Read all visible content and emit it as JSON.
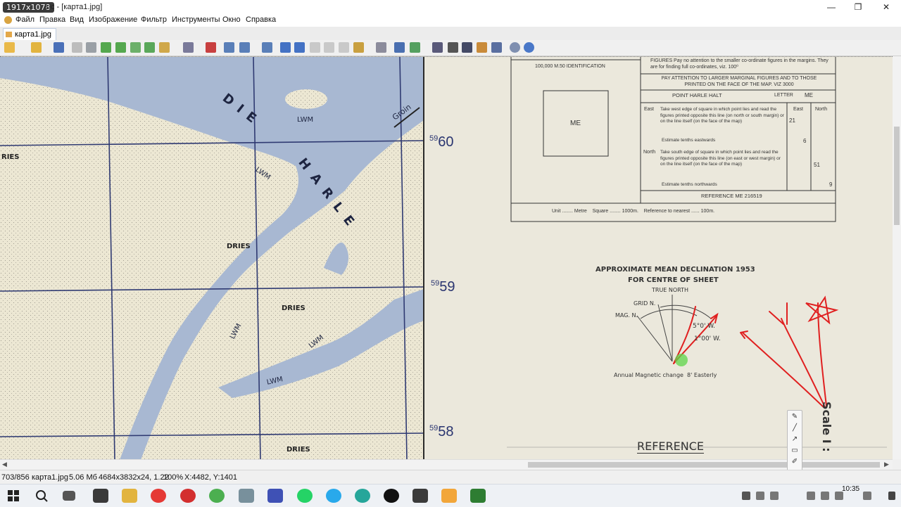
{
  "window": {
    "dims_badge": "1917x1078",
    "title": "sic - [карта1.jpg]",
    "controls": {
      "minimize": "—",
      "maximize": "❐",
      "close": "✕"
    }
  },
  "menubar": {
    "items": [
      "Файл",
      "Правка",
      "Вид",
      "Изображение",
      "Фильтр",
      "Инструменты",
      "Окно",
      "Справка"
    ],
    "mdi": {
      "minimize": "–",
      "restore": "▫",
      "close": "✕"
    }
  },
  "tab": {
    "label": "карта1.jpg"
  },
  "map_left": {
    "labels": {
      "die": "D I E",
      "harle": "H A R L E",
      "groin": "Groin",
      "lwm": "LWM",
      "ries": "RIES",
      "dries": "DRIES"
    },
    "grid": {
      "n60": "60",
      "n59": "59",
      "n58": "58",
      "prefix": "59"
    }
  },
  "reference_box": {
    "top_partial": "100,000 M.50  IDENTIFICATION",
    "square_label": "ME",
    "figures_note": "FIGURES  Pay no attention to the smaller co-ordinate figures in the margins. They are for finding full co-ordinates, viz. 100⁰",
    "attention_note": "PAY ATTENTION TO LARGER MARGINAL FIGURES AND TO THOSE PRINTED ON THE FACE OF THE MAP. VIZ 3000",
    "point_label": "POINT  HARLE HALT",
    "letter_label": "LETTER",
    "letter_value": "ME",
    "east_header": "East",
    "north_header": "North",
    "east_text": "Take west edge of square in which point lies and read the figures printed opposite this line (on north or south margin) or on the line itself (on the face of the map)",
    "east_value": "21",
    "east_tenths": "Estimate tenths eastwards",
    "east_tenths_value": "6",
    "north_text": "Take south edge of square in which point lies and read the figures printed opposite this line (on east or west margin) or on the line itself (on the face of the map)",
    "north_value": "51",
    "north_tenths": "Estimate tenths northwards",
    "north_tenths_value": "9",
    "reference": "REFERENCE  ME 216519",
    "unit_row": "Unit ........ Metre    Square ........ 1000m.    Reference to nearest ...... 100m."
  },
  "declination": {
    "title1": "APPROXIMATE MEAN DECLINATION 1953",
    "title2": "FOR CENTRE OF SHEET",
    "true_north": "TRUE NORTH",
    "grid_n": "GRID N.",
    "mag_n": "MAG. N.",
    "angle1": "5°0' W.",
    "angle2": "1°00' W.",
    "annual": "Annual Magnetic change  8' Easterly"
  },
  "reference_heading": "REFERENCE",
  "scale_text": "Scale I :",
  "statusbar": {
    "index": "703/856",
    "filename": "карта1.jpg",
    "size": "5.06 Мб",
    "dims": "4684x3832x24, 1.22",
    "zoom": "100%",
    "coords": "X:4482, Y:1401"
  },
  "taskbar": {
    "clock_time": "10:35"
  },
  "colors": {
    "water": "#a8b8d2",
    "land": "#ece7d3",
    "paper": "#ebe8dc",
    "grid": "#2f3a72",
    "annotation": "#e02020"
  }
}
